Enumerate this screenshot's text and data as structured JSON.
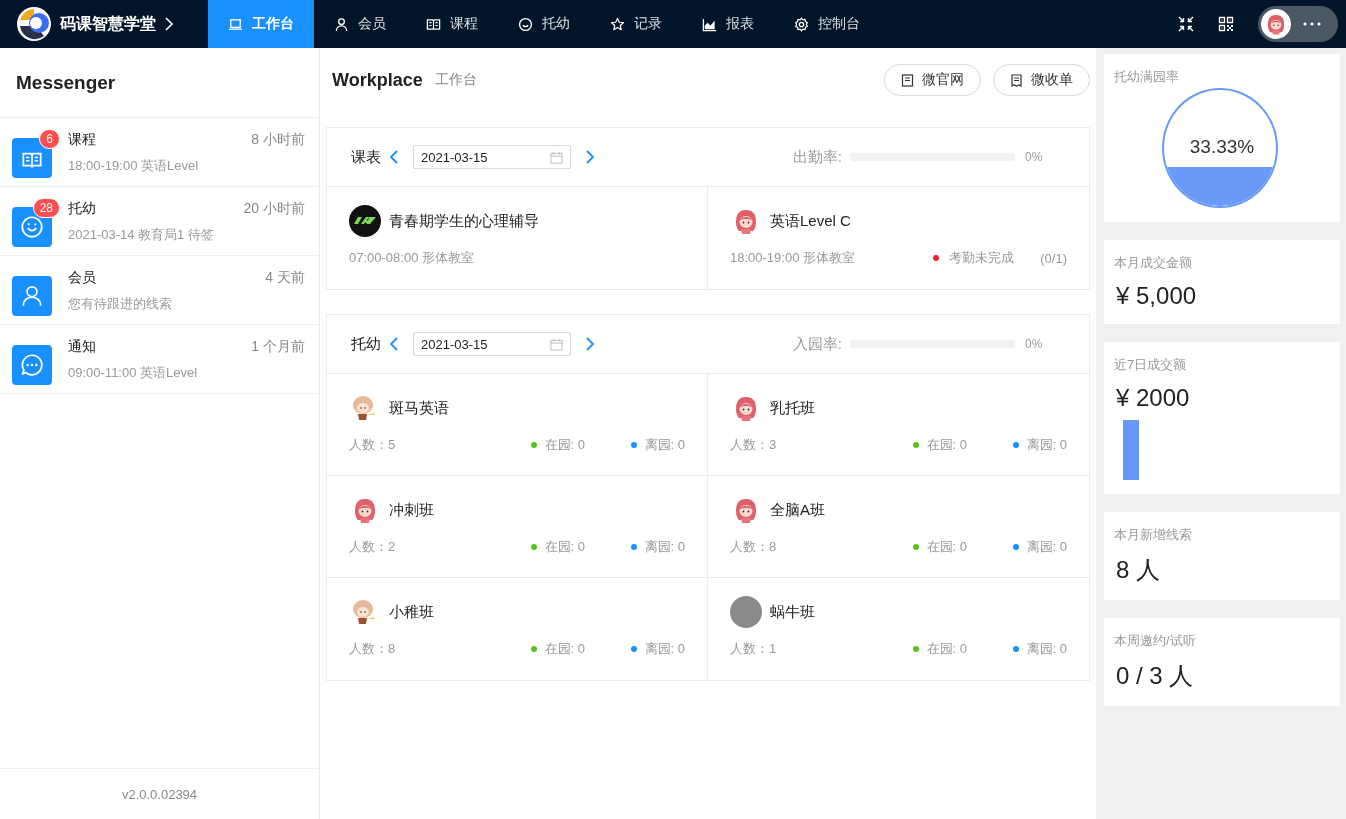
{
  "header": {
    "brand": "码课智慧学堂",
    "nav": [
      {
        "label": "工作台",
        "selected": true
      },
      {
        "label": "会员",
        "selected": false
      },
      {
        "label": "课程",
        "selected": false
      },
      {
        "label": "托幼",
        "selected": false
      },
      {
        "label": "记录",
        "selected": false
      },
      {
        "label": "报表",
        "selected": false
      },
      {
        "label": "控制台",
        "selected": false
      }
    ]
  },
  "messenger": {
    "title": "Messenger",
    "items": [
      {
        "title": "课程",
        "time": "8 小时前",
        "subtitle": "18:00-19:00 英语Level",
        "badge": "6"
      },
      {
        "title": "托幼",
        "time": "20 小时前",
        "subtitle": "2021-03-14 教育局1 待签",
        "badge": "28"
      },
      {
        "title": "会员",
        "time": "4 天前",
        "subtitle": "您有待跟进的线索"
      },
      {
        "title": "通知",
        "time": "1 个月前",
        "subtitle": "09:00-11:00 英语Level"
      }
    ],
    "version": "v2.0.0.02394"
  },
  "workplace": {
    "title": "Workplace",
    "subtitle": "工作台",
    "buttons": [
      "微官网",
      "微收单"
    ]
  },
  "schedule": {
    "label": "课表",
    "date": "2021-03-15",
    "rate_label": "出勤率:",
    "rate": "0%",
    "level": 0,
    "courses": [
      {
        "name": "青春期学生的心理辅导",
        "kind": "logo",
        "time": "07:00-08:00 形体教室"
      },
      {
        "name": "英语Level C",
        "kind": "girl",
        "time": "18:00-19:00 形体教室",
        "status": {
          "label": "考勤未完成",
          "color": "#f5222d"
        },
        "count": "(0/1)"
      }
    ]
  },
  "nursery": {
    "label": "托幼",
    "date": "2021-03-15",
    "rate_label": "入园率:",
    "rate": "0%",
    "level": 0,
    "classes": [
      {
        "name": "斑马英语",
        "kind": "doodle",
        "count": "人数：5",
        "statuses": [
          {
            "label": "在园: 0",
            "color": "#52c41a"
          },
          {
            "label": "离园: 0",
            "color": "#1890ff"
          }
        ]
      },
      {
        "name": "乳托班",
        "kind": "girl",
        "count": "人数：3",
        "statuses": [
          {
            "label": "在园: 0",
            "color": "#52c41a"
          },
          {
            "label": "离园: 0",
            "color": "#1890ff"
          }
        ]
      },
      {
        "name": "冲刺班",
        "kind": "girl",
        "count": "人数：2",
        "statuses": [
          {
            "label": "在园: 0",
            "color": "#52c41a"
          },
          {
            "label": "离园: 0",
            "color": "#1890ff"
          }
        ]
      },
      {
        "name": "全脑A班",
        "kind": "girl",
        "count": "人数：8",
        "statuses": [
          {
            "label": "在园: 0",
            "color": "#52c41a"
          },
          {
            "label": "离园: 0",
            "color": "#1890ff"
          }
        ]
      },
      {
        "name": "小稚班",
        "kind": "doodle",
        "count": "人数：8",
        "statuses": [
          {
            "label": "在园: 0",
            "color": "#52c41a"
          },
          {
            "label": "离园: 0",
            "color": "#1890ff"
          }
        ]
      },
      {
        "name": "蜗牛班",
        "kind": "photo",
        "count": "人数：1",
        "statuses": [
          {
            "label": "在园: 0",
            "color": "#52c41a"
          },
          {
            "label": "离园: 0",
            "color": "#1890ff"
          }
        ]
      }
    ]
  },
  "stats": [
    {
      "kind": "gauge",
      "title": "托幼满园率",
      "value": "33.33%",
      "level": 0.3333
    },
    {
      "kind": "value",
      "title": "本月成交金额",
      "value": "¥ 5,000"
    },
    {
      "kind": "bars",
      "title": "近7日成交额",
      "value": "¥ 2000"
    },
    {
      "kind": "value",
      "title": "本月新增线索",
      "value": "8 人"
    },
    {
      "kind": "value",
      "title": "本周邀约/试听",
      "value": "0 / 3 人"
    }
  ]
}
